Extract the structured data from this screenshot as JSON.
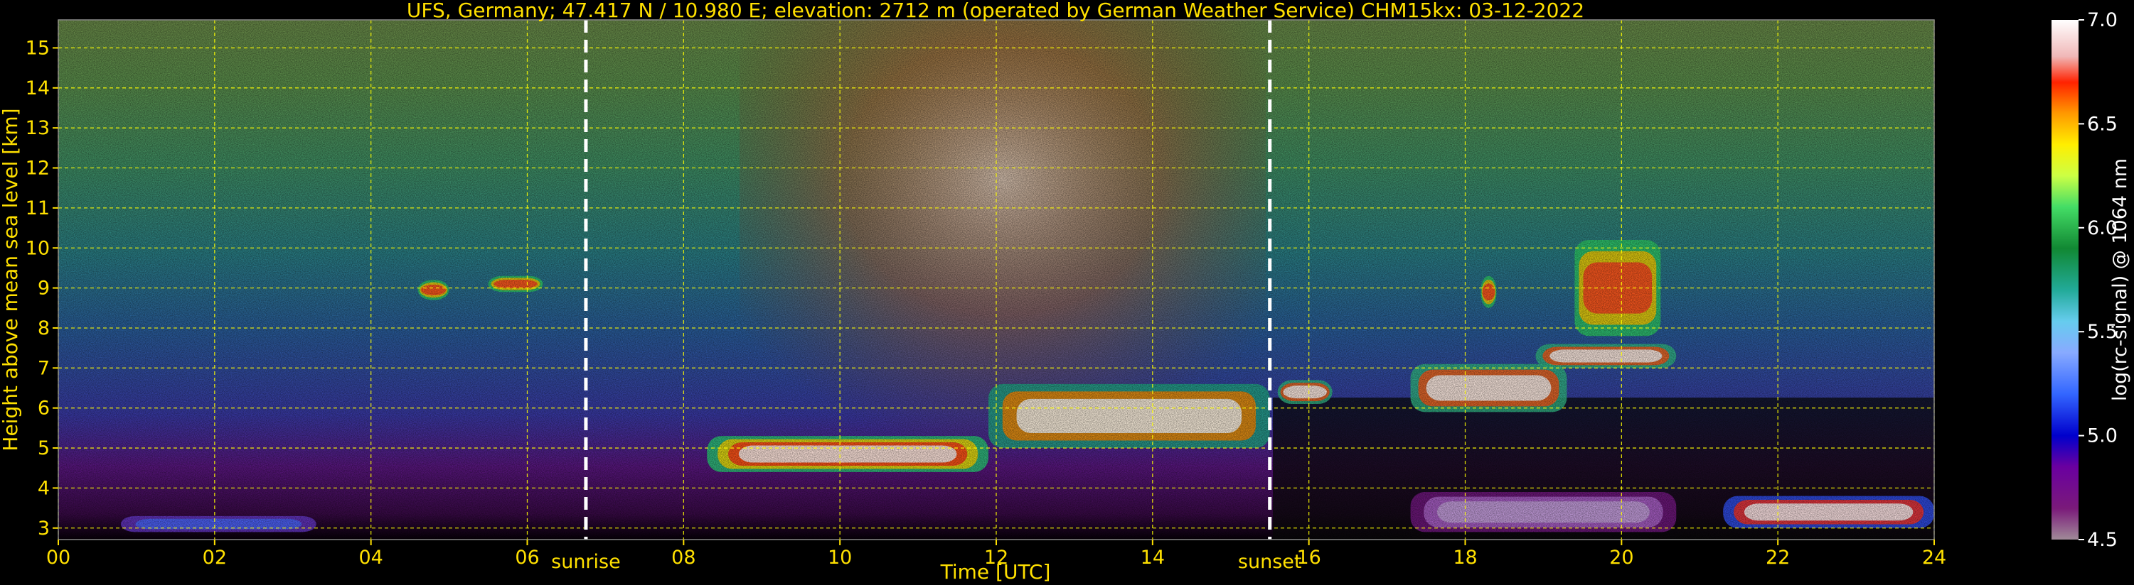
{
  "chart_data": {
    "type": "heatmap",
    "title": "UFS, Germany; 47.417 N / 10.980 E; elevation: 2712 m  (operated by German Weather Service)    CHM15kx: 03-12-2022",
    "xlabel": "Time [UTC]",
    "ylabel": "Height above mean sea level [km]",
    "colorbar_label": "log(rc-signal) @ 1064 nm",
    "xlim": [
      0,
      24
    ],
    "ylim": [
      2.712,
      15.7
    ],
    "x_ticks": [
      "00",
      "02",
      "04",
      "06",
      "08",
      "10",
      "12",
      "14",
      "16",
      "18",
      "20",
      "22",
      "24"
    ],
    "y_ticks": [
      "3",
      "4",
      "5",
      "6",
      "7",
      "8",
      "9",
      "10",
      "11",
      "12",
      "13",
      "14",
      "15"
    ],
    "colorbar_ticks": [
      "7.0",
      "6.5",
      "6.0",
      "5.5",
      "5.0",
      "4.5"
    ],
    "colorbar_range": [
      4.5,
      7.0
    ],
    "grid": true,
    "grid_color": "#ffff00",
    "text_color": "#ffe000",
    "background": "#000000",
    "annotations": [
      {
        "label": "sunrise",
        "time": 6.75
      },
      {
        "label": "sunset",
        "time": 15.5
      }
    ],
    "features": [
      {
        "kind": "aerosol_layer",
        "t_start": 8.3,
        "t_end": 11.9,
        "h_low": 4.4,
        "h_high": 5.3
      },
      {
        "kind": "cloud_ascending",
        "t_start": 11.9,
        "t_end": 15.5,
        "h_low": 5.0,
        "h_high": 6.6
      },
      {
        "kind": "cloud",
        "t_start": 15.6,
        "t_end": 16.3,
        "h_low": 6.1,
        "h_high": 6.7
      },
      {
        "kind": "cloud",
        "t_start": 17.3,
        "t_end": 19.3,
        "h_low": 5.9,
        "h_high": 7.1
      },
      {
        "kind": "cloud",
        "t_start": 18.9,
        "t_end": 20.7,
        "h_low": 7.0,
        "h_high": 7.6
      },
      {
        "kind": "cirrus",
        "t_start": 19.4,
        "t_end": 20.5,
        "h_low": 7.8,
        "h_high": 10.2
      },
      {
        "kind": "cirrus",
        "t_start": 18.2,
        "t_end": 18.4,
        "h_low": 8.5,
        "h_high": 9.3
      },
      {
        "kind": "cirrus",
        "t_start": 4.6,
        "t_end": 5.0,
        "h_low": 8.7,
        "h_high": 9.2
      },
      {
        "kind": "cirrus",
        "t_start": 5.5,
        "t_end": 6.2,
        "h_low": 8.9,
        "h_high": 9.3
      },
      {
        "kind": "low_cloud",
        "t_start": 21.3,
        "t_end": 24.0,
        "h_low": 3.0,
        "h_high": 3.8
      },
      {
        "kind": "boundary_layer",
        "t_start": 17.3,
        "t_end": 20.7,
        "h_low": 2.9,
        "h_high": 3.9
      },
      {
        "kind": "surface_layer",
        "t_start": 0.8,
        "t_end": 3.3,
        "h_low": 2.9,
        "h_high": 3.3
      }
    ]
  }
}
